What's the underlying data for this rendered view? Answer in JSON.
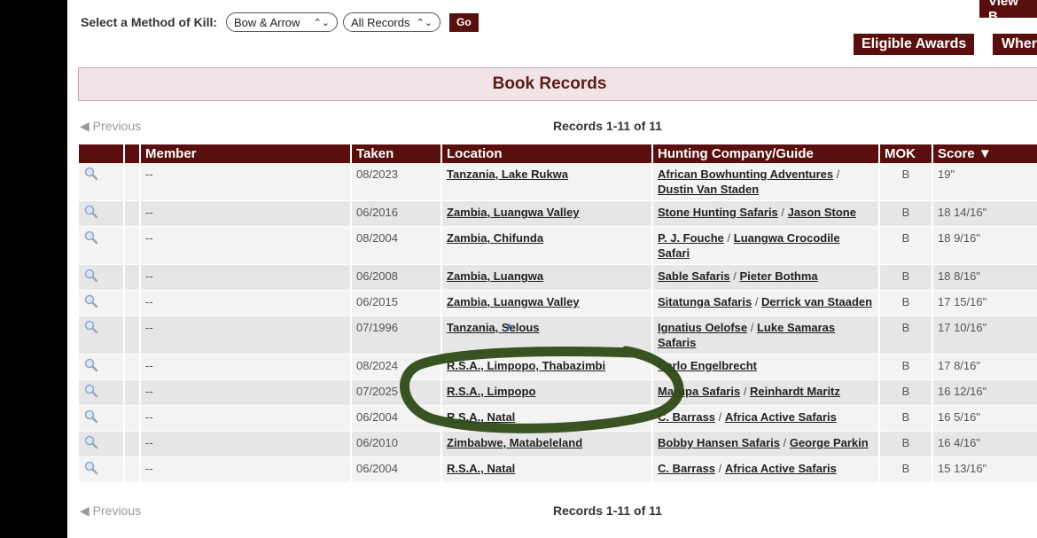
{
  "method_row": {
    "label": "Select a Method of Kill:",
    "method_value": "Bow & Arrow",
    "records_value": "All Records",
    "go_label": "Go"
  },
  "top_buttons": {
    "view_label": "View B",
    "eligible_label": "Eligible Awards",
    "where_label": "Wher"
  },
  "section_title": "Book Records",
  "pager": {
    "previous_label": "Previous",
    "count_label": "Records 1-11 of 11"
  },
  "table": {
    "headers": {
      "member": "Member",
      "taken": "Taken",
      "location": "Location",
      "company": "Hunting Company/Guide",
      "mok": "MOK",
      "score": "Score"
    },
    "rows": [
      {
        "member": "--",
        "taken": "08/2023",
        "location": "Tanzania, Lake Rukwa",
        "company": "African Bowhunting Adventures",
        "sep": " / ",
        "guide": "Dustin Van Staden",
        "mok": "B",
        "score": "19\""
      },
      {
        "member": "--",
        "taken": "06/2016",
        "location": "Zambia, Luangwa Valley",
        "company": "Stone Hunting Safaris",
        "sep": " / ",
        "guide": "Jason Stone",
        "mok": "B",
        "score": "18 14/16\""
      },
      {
        "member": "--",
        "taken": "08/2004",
        "location": "Zambia, Chifunda",
        "company": "P. J. Fouche",
        "sep": " / ",
        "guide": "Luangwa Crocodile Safari",
        "mok": "B",
        "score": "18 9/16\""
      },
      {
        "member": "--",
        "taken": "06/2008",
        "location": "Zambia, Luangwa",
        "company": "Sable Safaris",
        "sep": " / ",
        "guide": "Pieter Bothma",
        "mok": "B",
        "score": "18 8/16\""
      },
      {
        "member": "--",
        "taken": "06/2015",
        "location": "Zambia, Luangwa Valley",
        "company": "Sitatunga Safaris",
        "sep": " / ",
        "guide": "Derrick van Staaden",
        "mok": "B",
        "score": "17 15/16\""
      },
      {
        "member": "--",
        "taken": "07/1996",
        "location": "Tanzania, Selous",
        "company": "Ignatius Oelofse",
        "sep": " / ",
        "guide": "Luke Samaras Safaris",
        "mok": "B",
        "score": "17 10/16\""
      },
      {
        "member": "--",
        "taken": "08/2024",
        "location": "R.S.A., Limpopo, Thabazimbi",
        "company": "Carlo Engelbrecht",
        "sep": "",
        "guide": "",
        "mok": "B",
        "score": "17 8/16\""
      },
      {
        "member": "--",
        "taken": "07/2025",
        "location": "R.S.A., Limpopo",
        "company": "Marupa Safaris",
        "sep": " / ",
        "guide": "Reinhardt Maritz",
        "mok": "B",
        "score": "16 12/16\""
      },
      {
        "member": "--",
        "taken": "06/2004",
        "location": "R.S.A., Natal",
        "company": "C. Barrass",
        "sep": " / ",
        "guide": "Africa Active Safaris",
        "mok": "B",
        "score": "16 5/16\""
      },
      {
        "member": "--",
        "taken": "06/2010",
        "location": "Zimbabwe, Matabeleland",
        "company": "Bobby Hansen Safaris",
        "sep": " / ",
        "guide": "George Parkin",
        "mok": "B",
        "score": "16 4/16\""
      },
      {
        "member": "--",
        "taken": "06/2004",
        "location": "R.S.A., Natal",
        "company": "C. Barrass",
        "sep": " / ",
        "guide": "Africa Active Safaris",
        "mok": "B",
        "score": "15 13/16\""
      }
    ]
  },
  "colors": {
    "header_maroon": "#5a0f0f",
    "title_bg": "#f2e4e6",
    "ink_green": "#2f4a16"
  }
}
